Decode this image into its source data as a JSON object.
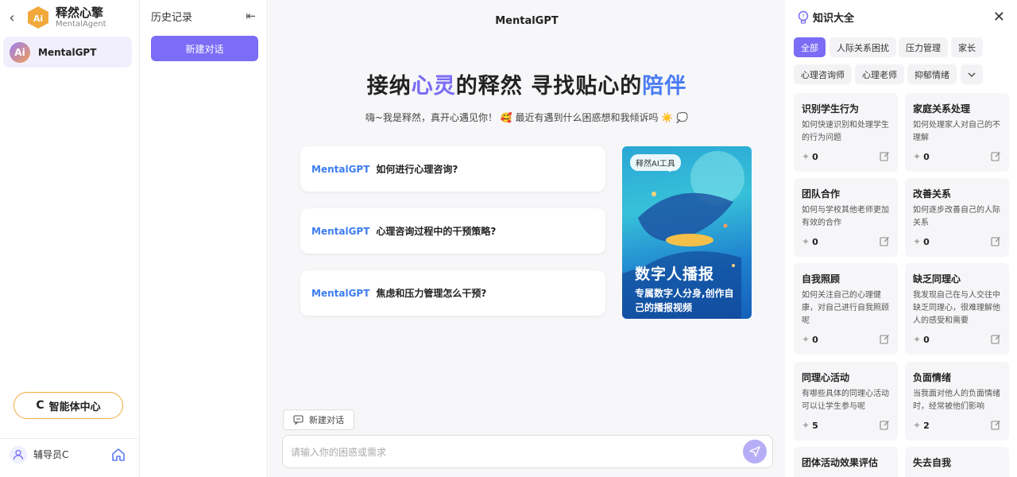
{
  "brand": {
    "name": "释然心擎",
    "sub": "MentalAgent",
    "logo_text": "Ai"
  },
  "agent": {
    "avatar": "Ai",
    "name": "MentalGPT"
  },
  "agent_center": {
    "icon": "C",
    "label": "智能体中心"
  },
  "user": {
    "name": "辅导员C"
  },
  "history": {
    "title": "历史记录",
    "new_chat": "新建对话"
  },
  "main": {
    "title": "MentalGPT",
    "hero": {
      "p1": "接纳",
      "h1": "心灵",
      "p2": "的释然 寻找贴心的",
      "h2": "陪伴"
    },
    "greeting": "嗨~我是释然，真开心遇见你！ 🥰 最近有遇到什么困惑想和我倾诉吗 ☀️ 💭",
    "questions": [
      {
        "brand": "MentalGPT",
        "text": "如何进行心理咨询?"
      },
      {
        "brand": "MentalGPT",
        "text": "心理咨询过程中的干预策略?"
      },
      {
        "brand": "MentalGPT",
        "text": "焦虑和压力管理怎么干预?"
      }
    ],
    "promo": {
      "tag": "释然AI工具",
      "title": "数字人播报",
      "subtitle": "专属数字人分身,创作自己的播报视频"
    },
    "tool_new_chat": "新建对话",
    "input_placeholder": "请输入你的困惑或需求"
  },
  "knowledge": {
    "title": "知识大全",
    "chips": [
      "全部",
      "人际关系困扰",
      "压力管理",
      "家长",
      "心理咨询师",
      "心理老师",
      "抑郁情绪"
    ],
    "cards": [
      {
        "title": "识别学生行为",
        "desc": "如何快速识别和处理学生的行为问题",
        "count": "0"
      },
      {
        "title": "家庭关系处理",
        "desc": "如何处理家人对自己的不理解",
        "count": "0"
      },
      {
        "title": "团队合作",
        "desc": "如何与学校其他老师更加有效的合作",
        "count": "0"
      },
      {
        "title": "改善关系",
        "desc": "如何逐步改善自己的人际关系",
        "count": "0"
      },
      {
        "title": "自我照顾",
        "desc": "如何关注自己的心理健康，对自己进行自我照顾呢",
        "count": "0"
      },
      {
        "title": "缺乏同理心",
        "desc": "我发现自己在与人交往中缺乏同理心，很难理解他人的感受和需要",
        "count": "0"
      },
      {
        "title": "同理心活动",
        "desc": "有哪些具体的同理心活动可以让学生参与呢",
        "count": "5"
      },
      {
        "title": "负面情绪",
        "desc": "当我面对他人的负面情绪时，经常被他们影响",
        "count": "2"
      },
      {
        "title": "团体活动效果评估",
        "desc": "",
        "count": ""
      },
      {
        "title": "失去自我",
        "desc": "",
        "count": ""
      }
    ]
  },
  "colors": {
    "accent": "#7b6df5",
    "brand_blue": "#3d7df0",
    "orange": "#f2a93b"
  }
}
